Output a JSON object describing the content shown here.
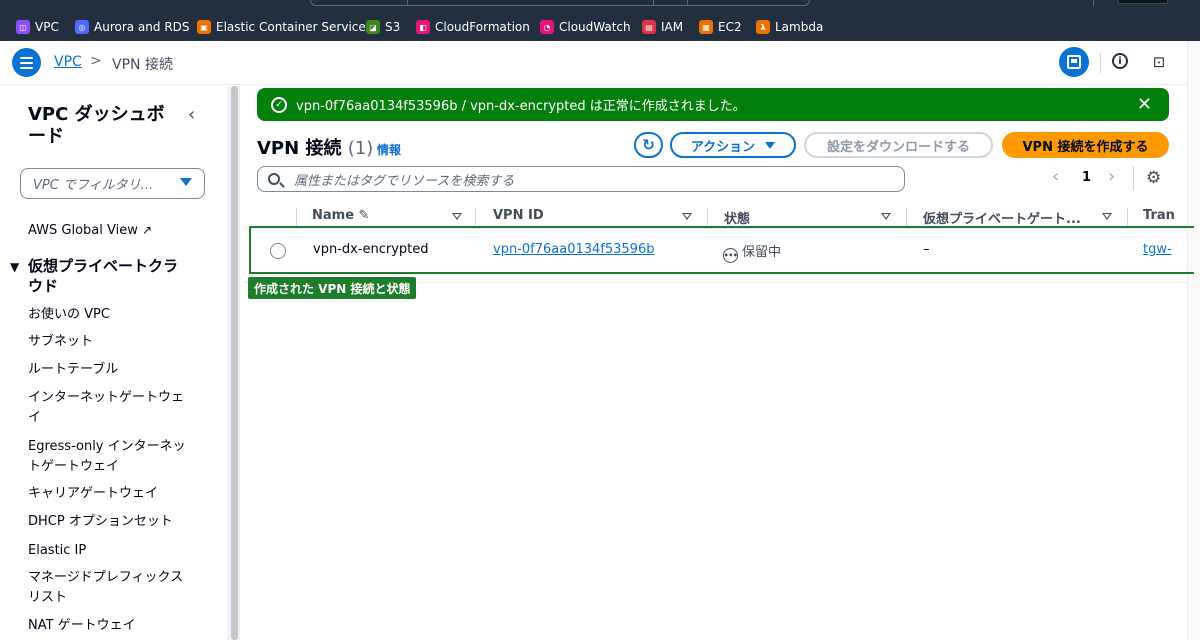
{
  "favorites": [
    {
      "label": "VPC",
      "icon": "vpc-icon",
      "color": "#8c4fff"
    },
    {
      "label": "Aurora and RDS",
      "icon": "rds-icon",
      "color": "#4d6bfe"
    },
    {
      "label": "Elastic Container Service",
      "icon": "ecs-icon",
      "color": "#ed7100"
    },
    {
      "label": "S3",
      "icon": "s3-icon",
      "color": "#3f8624"
    },
    {
      "label": "CloudFormation",
      "icon": "cloudformation-icon",
      "color": "#e7157b"
    },
    {
      "label": "CloudWatch",
      "icon": "cloudwatch-icon",
      "color": "#e7157b"
    },
    {
      "label": "IAM",
      "icon": "iam-icon",
      "color": "#dd344c"
    },
    {
      "label": "EC2",
      "icon": "ec2-icon",
      "color": "#ed7100"
    },
    {
      "label": "Lambda",
      "icon": "lambda-icon",
      "color": "#ed7100"
    }
  ],
  "breadcrumb": {
    "root": "VPC",
    "separator": ">",
    "current": "VPN 接続"
  },
  "sidebar": {
    "title": "VPC ダッシュボード",
    "filter_placeholder": "VPC でフィルタリ...",
    "global_view": "AWS Global View",
    "section": "仮想プライベートクラウド",
    "items": [
      "お使いの VPC",
      "サブネット",
      "ルートテーブル",
      "インターネットゲートウェイ",
      "Egress-only インターネットゲートウェイ",
      "キャリアゲートウェイ",
      "DHCP オプションセット",
      "Elastic IP",
      "マネージドプレフィックスリスト",
      "NAT ゲートウェイ"
    ]
  },
  "flash": {
    "message": "vpn-0f76aa0134f53596b / vpn-dx-encrypted は正常に作成されました。",
    "type": "success",
    "color": "#037f0c"
  },
  "header": {
    "title": "VPN 接続",
    "count": "(1)",
    "info": "情報"
  },
  "buttons": {
    "actions": "アクション",
    "download": "設定をダウンロードする",
    "create": "VPN 接続を作成する",
    "create_color": "#ff9900"
  },
  "search": {
    "placeholder": "属性またはタグでリソースを検索する"
  },
  "pagination": {
    "current_page": "1"
  },
  "table": {
    "columns": [
      "Name",
      "VPN ID",
      "状態",
      "仮想プライベートゲート...",
      "Tran"
    ],
    "rows": [
      {
        "name": "vpn-dx-encrypted",
        "vpn_id": "vpn-0f76aa0134f53596b",
        "state": "保留中",
        "vgw": "–",
        "transit": "tgw-"
      }
    ]
  },
  "annotation": {
    "label": "作成された VPN 接続と状態",
    "color": "#1d7d2c"
  }
}
